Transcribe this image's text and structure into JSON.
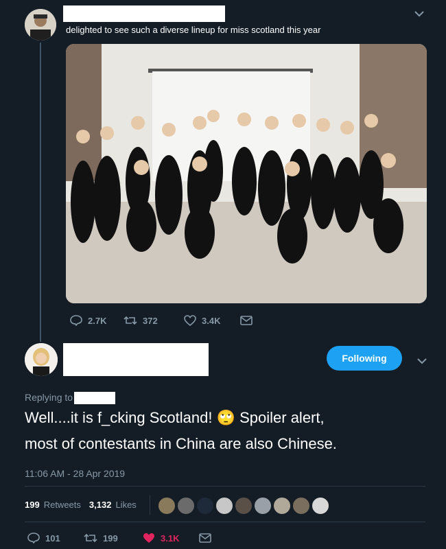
{
  "tweet1": {
    "text": "delighted to see such a diverse lineup for miss scotland this year",
    "reply_count": "2.7K",
    "retweet_count": "372",
    "like_count": "3.4K"
  },
  "tweet2": {
    "follow_label": "Following",
    "replying_to_label": "Replying to",
    "text_line1": "Well....it is f_cking Scotland! 🙄 Spoiler alert,",
    "text_line2": "most of contestants in China are also Chinese.",
    "timestamp": "11:06 AM - 28 Apr 2019",
    "retweets_num": "199",
    "retweets_label": "Retweets",
    "likes_num": "3,132",
    "likes_label": "Likes",
    "reply_count": "101",
    "retweet_count": "199",
    "like_count": "3.1K"
  },
  "colors": {
    "background": "#141d26",
    "accent": "#1da1f2",
    "muted": "#8899a6",
    "like_active": "#e0245e"
  },
  "icons": [
    "reply-icon",
    "retweet-icon",
    "heart-icon",
    "message-icon",
    "chevron-down-icon"
  ]
}
